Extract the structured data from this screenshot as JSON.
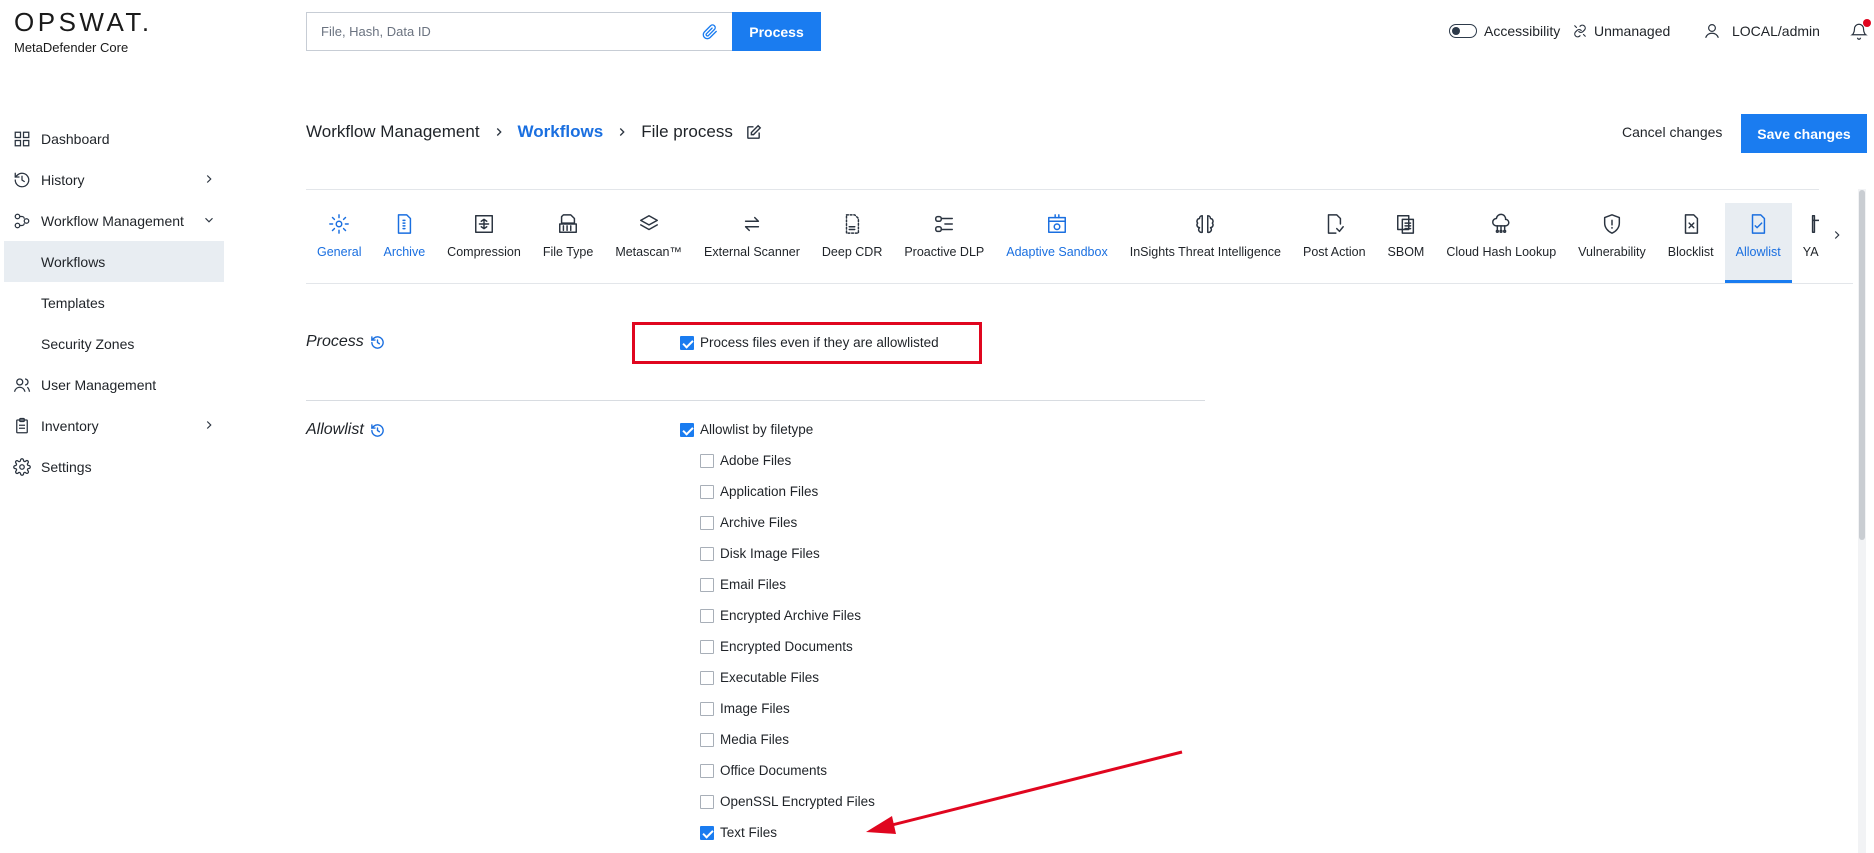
{
  "header": {
    "brand": "OPSWAT.",
    "product": "MetaDefender Core",
    "search_placeholder": "File, Hash, Data ID",
    "process_label": "Process",
    "accessibility_label": "Accessibility",
    "unmanaged_label": "Unmanaged",
    "user_label": "LOCAL/admin"
  },
  "sidebar": {
    "items": [
      {
        "label": "Dashboard",
        "icon": "dashboard-icon"
      },
      {
        "label": "History",
        "icon": "history-icon",
        "expandable": true
      },
      {
        "label": "Workflow Management",
        "icon": "workflow-icon",
        "expanded": true
      },
      {
        "label": "User Management",
        "icon": "users-icon"
      },
      {
        "label": "Inventory",
        "icon": "clipboard-icon",
        "expandable": true
      },
      {
        "label": "Settings",
        "icon": "gear-icon"
      }
    ],
    "sub_items": [
      {
        "label": "Workflows",
        "active": true
      },
      {
        "label": "Templates"
      },
      {
        "label": "Security Zones"
      }
    ]
  },
  "breadcrumb": {
    "root": "Workflow Management",
    "link": "Workflows",
    "current": "File process"
  },
  "actions": {
    "cancel_label": "Cancel changes",
    "save_label": "Save changes"
  },
  "tabs": [
    {
      "label": "General",
      "icon": "gear-icon",
      "style": "blue"
    },
    {
      "label": "Archive",
      "icon": "archive-file-icon",
      "style": "blue"
    },
    {
      "label": "Compression",
      "icon": "compression-icon"
    },
    {
      "label": "File Type",
      "icon": "file-type-icon"
    },
    {
      "label": "Metascan™",
      "icon": "layers-icon"
    },
    {
      "label": "External Scanner",
      "icon": "swap-arrows-icon"
    },
    {
      "label": "Deep CDR",
      "icon": "deep-cdr-icon"
    },
    {
      "label": "Proactive DLP",
      "icon": "dlp-icon"
    },
    {
      "label": "Adaptive Sandbox",
      "icon": "sandbox-icon",
      "style": "blue"
    },
    {
      "label": "InSights Threat Intelligence",
      "icon": "brain-icon"
    },
    {
      "label": "Post Action",
      "icon": "post-action-icon"
    },
    {
      "label": "SBOM",
      "icon": "sbom-icon"
    },
    {
      "label": "Cloud Hash Lookup",
      "icon": "cloud-network-icon"
    },
    {
      "label": "Vulnerability",
      "icon": "shield-alert-icon"
    },
    {
      "label": "Blocklist",
      "icon": "blocklist-file-icon"
    },
    {
      "label": "Allowlist",
      "icon": "allowlist-file-icon",
      "style": "active"
    },
    {
      "label": "YARA",
      "icon": "yara-icon"
    }
  ],
  "process_section": {
    "title": "Process",
    "option_label": "Process files even if they are allowlisted",
    "option_checked": true
  },
  "allowlist_section": {
    "title": "Allowlist",
    "parent_label": "Allowlist by filetype",
    "parent_checked": true,
    "filetypes": [
      {
        "label": "Adobe Files",
        "checked": false
      },
      {
        "label": "Application Files",
        "checked": false
      },
      {
        "label": "Archive Files",
        "checked": false
      },
      {
        "label": "Disk Image Files",
        "checked": false
      },
      {
        "label": "Email Files",
        "checked": false
      },
      {
        "label": "Encrypted Archive Files",
        "checked": false
      },
      {
        "label": "Encrypted Documents",
        "checked": false
      },
      {
        "label": "Executable Files",
        "checked": false
      },
      {
        "label": "Image Files",
        "checked": false
      },
      {
        "label": "Media Files",
        "checked": false
      },
      {
        "label": "Office Documents",
        "checked": false
      },
      {
        "label": "OpenSSL Encrypted Files",
        "checked": false
      },
      {
        "label": "Text Files",
        "checked": true
      }
    ]
  },
  "colors": {
    "accent": "#1a7cf0",
    "link": "#1a6fe0",
    "annotation": "#e0061f",
    "active_bg": "#e8edf2"
  }
}
